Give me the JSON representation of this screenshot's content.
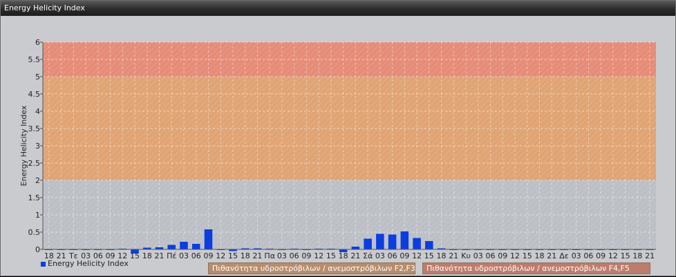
{
  "window": {
    "title": "Energy Helicity Index"
  },
  "legend": {
    "series_label": "Energy Helicity Index",
    "swatch_color": "#0a3ee0"
  },
  "bands": [
    {
      "label": "Πιθανότητα υδροστρόβιλων / ανεμοστρόβιλων F2,F3",
      "from": 2,
      "to": 5,
      "color": "#e0a474"
    },
    {
      "label": "Πιθανότητα υδροστρόβιλων / ανεμοστρόβιλων F4,F5",
      "from": 5,
      "to": 6,
      "color": "#e58c78"
    }
  ],
  "chart_data": {
    "type": "bar",
    "title": "",
    "xlabel": "",
    "ylabel": "Energy Helicity Index",
    "ylim": [
      0,
      6
    ],
    "yticks": [
      "0",
      "0.5",
      "1",
      "1.5",
      "2",
      "2.5",
      "3",
      "3.5",
      "4",
      "4.5",
      "5",
      "5.5",
      "6"
    ],
    "grid": true,
    "legend_position": "bottom-left",
    "categories": [
      "18",
      "21",
      "Τε",
      "03",
      "06",
      "09",
      "12",
      "15",
      "18",
      "21",
      "Πέ",
      "03",
      "06",
      "09",
      "12",
      "15",
      "18",
      "21",
      "Πα",
      "03",
      "06",
      "09",
      "12",
      "15",
      "18",
      "21",
      "Σά",
      "03",
      "06",
      "09",
      "12",
      "15",
      "18",
      "21",
      "Κυ",
      "03",
      "06",
      "09",
      "12",
      "15",
      "18",
      "21",
      "Δε",
      "03",
      "06",
      "09",
      "12",
      "15",
      "18",
      "21"
    ],
    "series": [
      {
        "name": "Energy Helicity Index",
        "color": "#0a3ee0",
        "values": [
          0.01,
          0.01,
          0.01,
          0.01,
          0.01,
          0.01,
          0.02,
          -0.12,
          0.05,
          0.06,
          0.13,
          0.22,
          0.16,
          0.58,
          0.01,
          -0.05,
          0.03,
          0.03,
          0.02,
          0.01,
          0.02,
          0.01,
          0.02,
          0.02,
          -0.08,
          0.08,
          0.31,
          0.45,
          0.43,
          0.52,
          0.33,
          0.24,
          0.03,
          0.01,
          0.01,
          0.01,
          0.01,
          0.01,
          0.01,
          0.01,
          0.01,
          0.01,
          0.01,
          0.01,
          0.01,
          0.01,
          0.01,
          0.01,
          0.01,
          0.01
        ]
      }
    ]
  }
}
